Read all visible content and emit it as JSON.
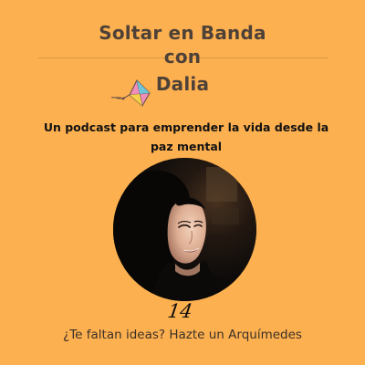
{
  "podcast": {
    "title_line_1": "Soltar en Banda",
    "title_line_2": "con",
    "title_line_3": "Dalia",
    "tagline": "Un podcast para emprender la vida desde la  paz mental"
  },
  "episode": {
    "number": "14",
    "title": "¿Te faltan ideas? Hazte un Arquímedes"
  },
  "colors": {
    "background": "#FDB04F",
    "title_text": "#4E4138",
    "tagline_text": "#121212",
    "kite_pink": "#F08DB8",
    "kite_blue": "#6FC4D6",
    "kite_yellow": "#F6D24A"
  },
  "icons": {
    "kite": "kite-icon",
    "portrait": "host-portrait"
  }
}
